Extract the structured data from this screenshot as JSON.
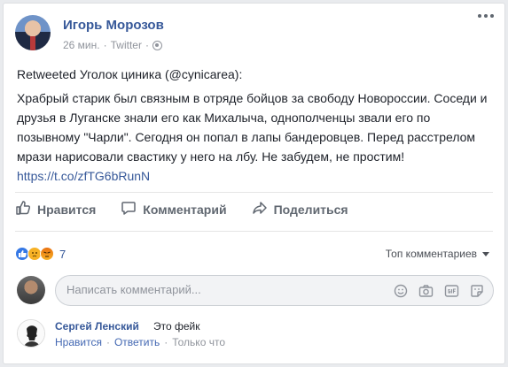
{
  "post": {
    "author": "Игорь Морозов",
    "time": "26 мин.",
    "separator": "·",
    "source": "Twitter",
    "separator2": "·",
    "retweet_line": "Retweeted Уголок циника (@cynicarea):",
    "body": "Храбрый старик был связным в отряде бойцов за свободу Новороссии. Соседи и друзья в Луганске знали его как Михалыча, однополченцы звали его по позывному \"Чарли\". Сегодня он попал в лапы бандеровцев. Перед расстрелом мрази нарисовали свастику у него на лбу. Не забудем, не простим!",
    "link": "https://t.co/zfTG6bRunN"
  },
  "actions": {
    "like": "Нравится",
    "comment": "Комментарий",
    "share": "Поделиться"
  },
  "reactions": {
    "count": "7"
  },
  "sort_label": "Топ комментариев",
  "comment_input": {
    "placeholder": "Написать комментарий..."
  },
  "comments": [
    {
      "author": "Сергей Ленский",
      "text": "Это фейк",
      "like": "Нравится",
      "reply": "Ответить",
      "dot1": "·",
      "dot2": "·",
      "time": "Только что"
    }
  ],
  "colors": {
    "link": "#365899",
    "muted": "#90949c",
    "background": "#e9ebee"
  }
}
